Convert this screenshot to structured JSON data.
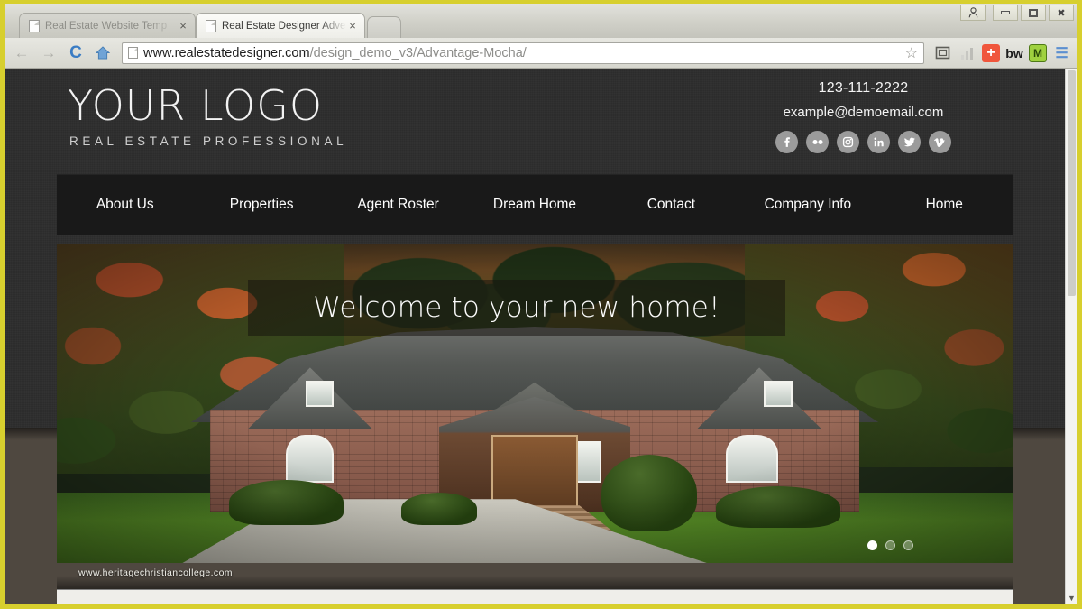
{
  "browser": {
    "tabs": [
      {
        "title": "Real Estate Website Temp",
        "close": "×",
        "active": false
      },
      {
        "title": "Real Estate Designer Adve",
        "close": "×",
        "active": true
      }
    ],
    "new_tab_label": "",
    "window_controls": {
      "user": "⚹",
      "minimize": "minimize-icon",
      "maximize": "maximize-icon",
      "close": "✖"
    },
    "nav": {
      "back": "←",
      "forward": "→",
      "reload": "C",
      "home": "⌂"
    },
    "url": {
      "host": "www.realestatedesigner.com",
      "path": "/design_demo_v3/Advantage-Mocha/",
      "full": "www.realestatedesigner.com/design_demo_v3/Advantage-Mocha/"
    },
    "bookmark_star": "☆",
    "extensions": [
      {
        "name": "screen-capture-icon",
        "glyph": "▣"
      },
      {
        "name": "analytics-bars-icon",
        "glyph": "▃▅▇"
      },
      {
        "name": "add-plus-icon",
        "glyph": "+"
      },
      {
        "name": "bitly-bw-icon",
        "glyph": "bw"
      },
      {
        "name": "mcafee-shield-icon",
        "glyph": "M"
      },
      {
        "name": "chrome-menu-icon",
        "glyph": "☰"
      }
    ]
  },
  "site": {
    "logo": {
      "title": "YOUR LOGO",
      "tagline": "REAL ESTATE PROFESSIONAL"
    },
    "contact": {
      "phone": "123-111-2222",
      "email": "example@demoemail.com"
    },
    "socials": [
      {
        "name": "facebook-icon",
        "glyph": "f"
      },
      {
        "name": "flickr-icon",
        "glyph": "••"
      },
      {
        "name": "instagram-icon",
        "glyph": "▣"
      },
      {
        "name": "linkedin-icon",
        "glyph": "in"
      },
      {
        "name": "twitter-icon",
        "glyph": "t"
      },
      {
        "name": "vimeo-icon",
        "glyph": "v"
      }
    ],
    "nav_items": [
      "About Us",
      "Properties",
      "Agent Roster",
      "Dream Home",
      "Contact",
      "Company Info",
      "Home"
    ],
    "hero": {
      "caption": "Welcome to your new home!",
      "watermark": "www.heritagechristiancollege.com",
      "slide_count": 3,
      "active_slide": 1
    },
    "colors": {
      "header_dark": "#2e2e2e",
      "nav_dark": "#191919",
      "page_mocha": "#4f4840",
      "text_light": "#f2f2f2",
      "social_circle": "#9b9b9b",
      "frame_yellow": "#d7cf2e"
    }
  }
}
